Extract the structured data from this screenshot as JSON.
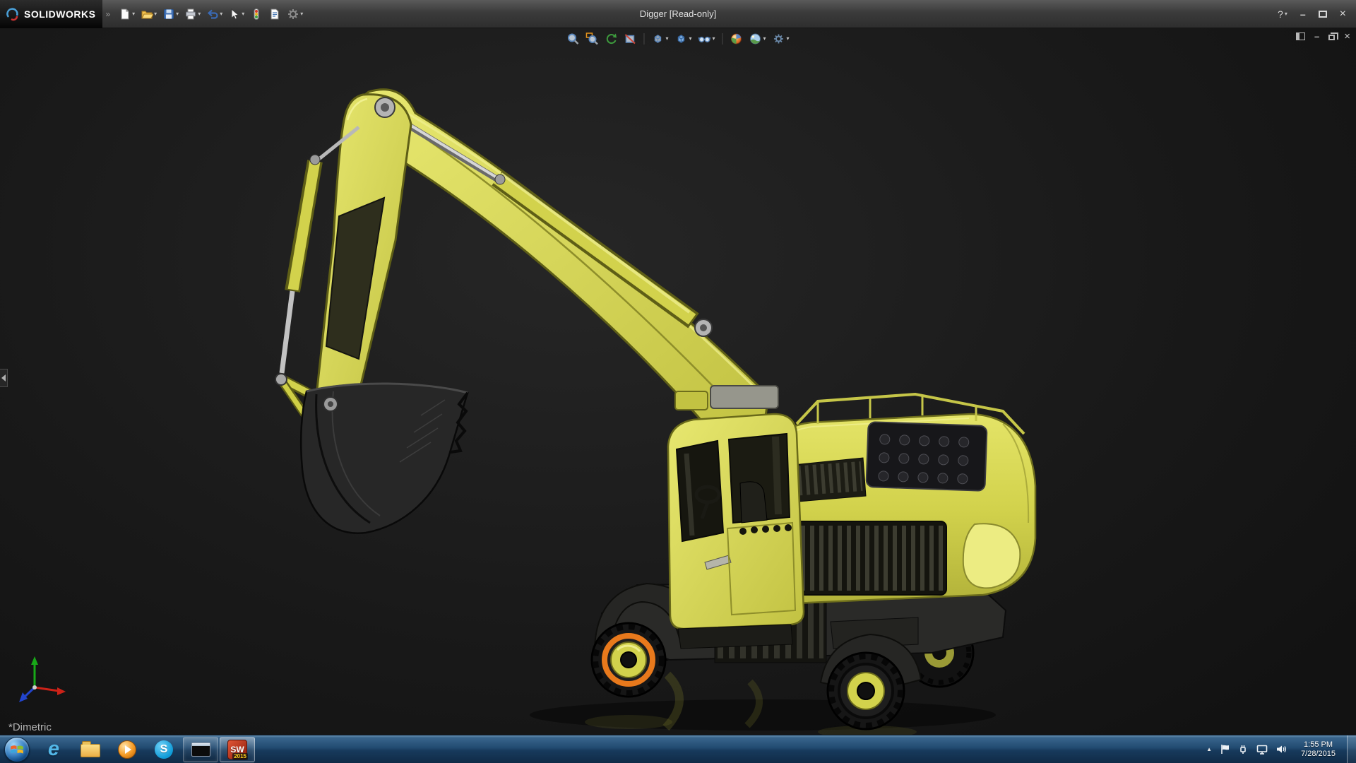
{
  "glyphs": {
    "dropdown": "▾",
    "minimize": "–",
    "close": "×",
    "help": "?",
    "overflow": "»",
    "hidden_icons": "▲"
  },
  "window": {
    "brand": "SOLIDWORKS",
    "title": "Digger [Read-only]",
    "toolbar_icons": [
      "new-document",
      "open",
      "save",
      "print",
      "undo",
      "select",
      "rebuild",
      "file-properties",
      "options"
    ]
  },
  "headsup_toolbar": {
    "icons": [
      "zoom-to-fit",
      "zoom-to-area",
      "previous-view",
      "section-view",
      "view-orientation",
      "display-style",
      "hide-show-items",
      "edit-appearance",
      "apply-scene",
      "view-settings"
    ]
  },
  "document_controls": [
    "feature-pane-toggle",
    "minimize-document",
    "restore-document",
    "close-document"
  ],
  "viewport": {
    "orientation_label": "*Dimetric",
    "background_color": "#1c1c1c",
    "model": {
      "subject": "wheeled excavator",
      "body_color": "#d2d24c",
      "selection_color": "#e8791c",
      "selected_component": "front-wheel-hub"
    },
    "triad_colors": {
      "x_red": "#cc2218",
      "y_green": "#18a818",
      "z_blue": "#2244cc"
    }
  },
  "taskbar": {
    "apps": [
      "internet-explorer",
      "windows-explorer",
      "media-player",
      "skype",
      "command-prompt",
      "solidworks"
    ],
    "app_glyphs": {
      "internet_explorer": "e",
      "skype": "S",
      "solidworks": "SW",
      "solidworks_badge": "2015"
    },
    "tray_icons": [
      "show-hidden-icons",
      "action-center-flag",
      "power-plug",
      "network-display",
      "volume"
    ],
    "clock": {
      "time": "1:55 PM",
      "date": "7/28/2015"
    }
  }
}
